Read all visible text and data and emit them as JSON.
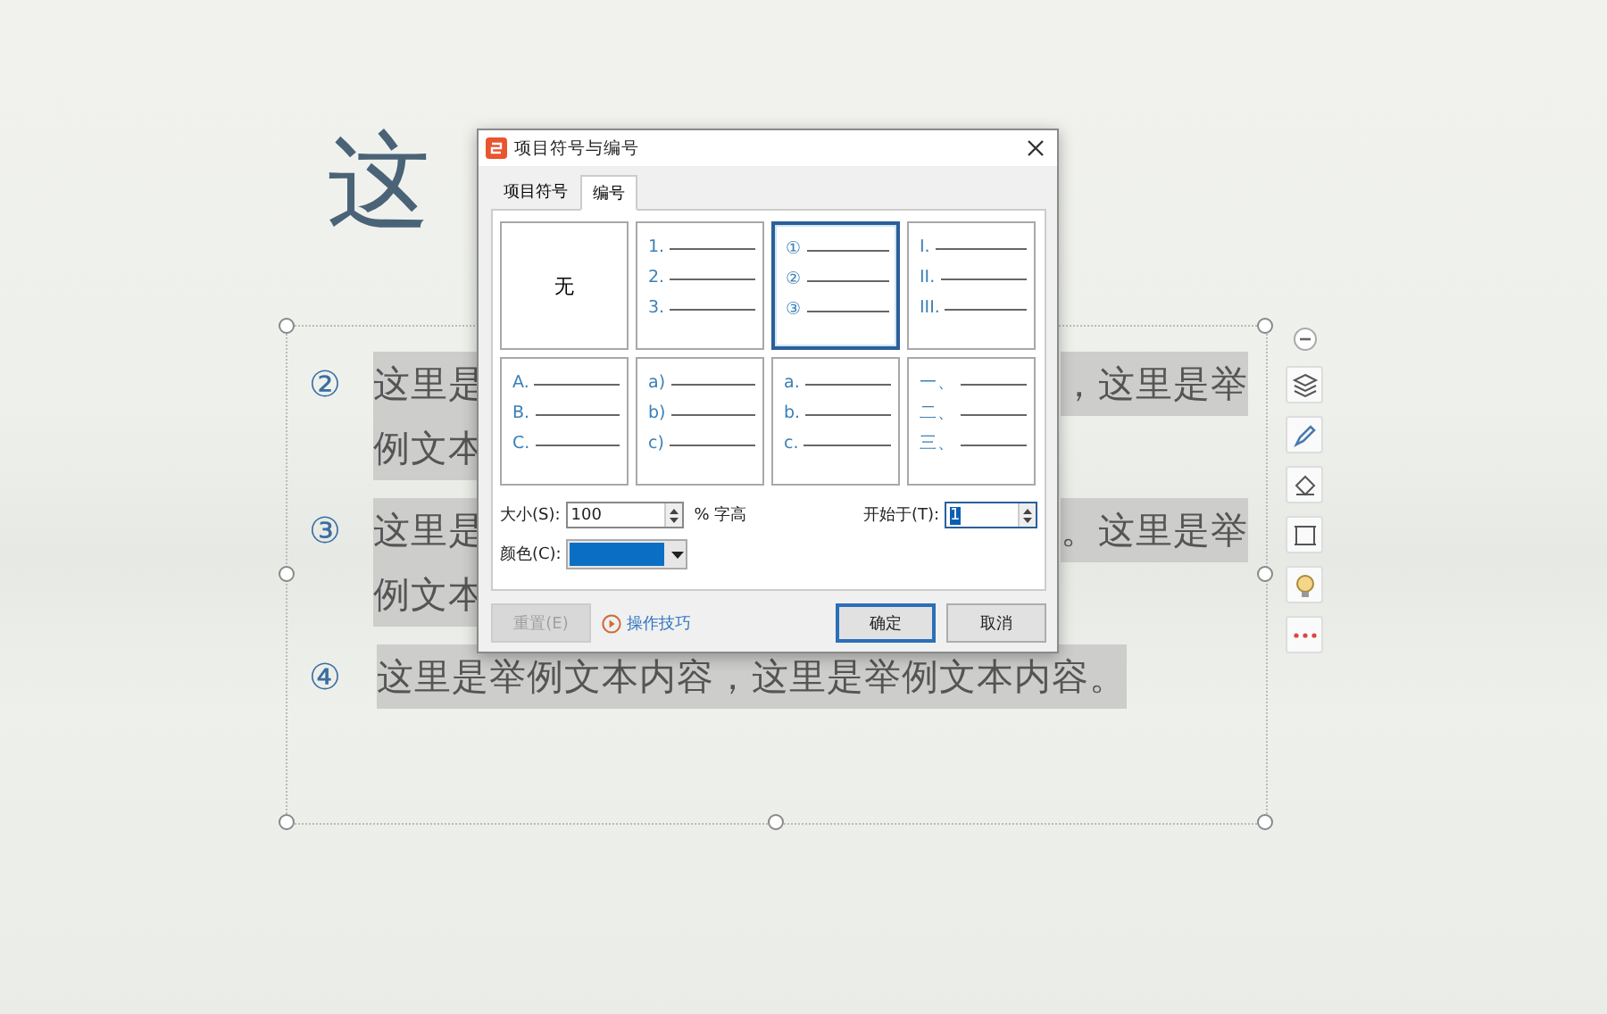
{
  "slide": {
    "title": "这",
    "items": [
      {
        "number": "②",
        "lines": [
          {
            "left": "这里是",
            "right": "，这里是举"
          },
          {
            "left": "例文本"
          }
        ]
      },
      {
        "number": "③",
        "lines": [
          {
            "left": "这里是",
            "right": "。这里是举"
          },
          {
            "left": "例文本"
          }
        ]
      },
      {
        "number": "④",
        "lines": [
          {
            "left": "这里是举例文本内容，这里是举例文本内容。"
          }
        ]
      }
    ]
  },
  "side_toolbar": [
    {
      "kind": "collapse"
    },
    {
      "kind": "layers"
    },
    {
      "kind": "pen"
    },
    {
      "kind": "fill"
    },
    {
      "kind": "frame"
    },
    {
      "kind": "bulb"
    },
    {
      "kind": "more"
    }
  ],
  "dialog": {
    "title": "项目符号与编号",
    "tabs": [
      {
        "label": "项目符号",
        "selected": false
      },
      {
        "label": "编号",
        "selected": true
      }
    ],
    "styles": [
      {
        "kind": "none",
        "label": "无",
        "selected": false
      },
      {
        "kind": "list",
        "markers": [
          "1.",
          "2.",
          "3."
        ],
        "selected": false
      },
      {
        "kind": "list",
        "markers": [
          "①",
          "②",
          "③"
        ],
        "selected": true
      },
      {
        "kind": "list",
        "markers": [
          "I.",
          "II.",
          "III."
        ],
        "selected": false
      },
      {
        "kind": "list",
        "markers": [
          "A.",
          "B.",
          "C."
        ],
        "selected": false
      },
      {
        "kind": "list",
        "markers": [
          "a)",
          "b)",
          "c)"
        ],
        "selected": false
      },
      {
        "kind": "list",
        "markers": [
          "a.",
          "b.",
          "c."
        ],
        "selected": false
      },
      {
        "kind": "list",
        "markers": [
          "一、",
          "二、",
          "三、"
        ],
        "selected": false
      }
    ],
    "size": {
      "label": "大小(S):",
      "value": "100",
      "unit": "% 字高"
    },
    "start": {
      "label": "开始于(T):",
      "value": "1"
    },
    "color": {
      "label": "颜色(C):",
      "color": "#0a6fc4"
    },
    "reset_button": {
      "label": "重置(E)",
      "disabled": true
    },
    "tips_link": "操作技巧",
    "ok_button": "确定",
    "cancel_button": "取消"
  }
}
